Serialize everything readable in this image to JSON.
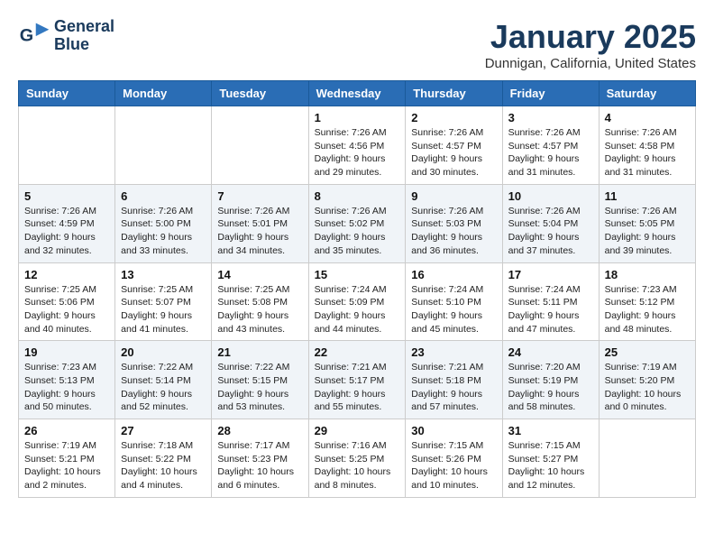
{
  "logo": {
    "line1": "General",
    "line2": "Blue"
  },
  "title": "January 2025",
  "location": "Dunnigan, California, United States",
  "days_of_week": [
    "Sunday",
    "Monday",
    "Tuesday",
    "Wednesday",
    "Thursday",
    "Friday",
    "Saturday"
  ],
  "weeks": [
    [
      {
        "day": "",
        "info": ""
      },
      {
        "day": "",
        "info": ""
      },
      {
        "day": "",
        "info": ""
      },
      {
        "day": "1",
        "info": "Sunrise: 7:26 AM\nSunset: 4:56 PM\nDaylight: 9 hours\nand 29 minutes."
      },
      {
        "day": "2",
        "info": "Sunrise: 7:26 AM\nSunset: 4:57 PM\nDaylight: 9 hours\nand 30 minutes."
      },
      {
        "day": "3",
        "info": "Sunrise: 7:26 AM\nSunset: 4:57 PM\nDaylight: 9 hours\nand 31 minutes."
      },
      {
        "day": "4",
        "info": "Sunrise: 7:26 AM\nSunset: 4:58 PM\nDaylight: 9 hours\nand 31 minutes."
      }
    ],
    [
      {
        "day": "5",
        "info": "Sunrise: 7:26 AM\nSunset: 4:59 PM\nDaylight: 9 hours\nand 32 minutes."
      },
      {
        "day": "6",
        "info": "Sunrise: 7:26 AM\nSunset: 5:00 PM\nDaylight: 9 hours\nand 33 minutes."
      },
      {
        "day": "7",
        "info": "Sunrise: 7:26 AM\nSunset: 5:01 PM\nDaylight: 9 hours\nand 34 minutes."
      },
      {
        "day": "8",
        "info": "Sunrise: 7:26 AM\nSunset: 5:02 PM\nDaylight: 9 hours\nand 35 minutes."
      },
      {
        "day": "9",
        "info": "Sunrise: 7:26 AM\nSunset: 5:03 PM\nDaylight: 9 hours\nand 36 minutes."
      },
      {
        "day": "10",
        "info": "Sunrise: 7:26 AM\nSunset: 5:04 PM\nDaylight: 9 hours\nand 37 minutes."
      },
      {
        "day": "11",
        "info": "Sunrise: 7:26 AM\nSunset: 5:05 PM\nDaylight: 9 hours\nand 39 minutes."
      }
    ],
    [
      {
        "day": "12",
        "info": "Sunrise: 7:25 AM\nSunset: 5:06 PM\nDaylight: 9 hours\nand 40 minutes."
      },
      {
        "day": "13",
        "info": "Sunrise: 7:25 AM\nSunset: 5:07 PM\nDaylight: 9 hours\nand 41 minutes."
      },
      {
        "day": "14",
        "info": "Sunrise: 7:25 AM\nSunset: 5:08 PM\nDaylight: 9 hours\nand 43 minutes."
      },
      {
        "day": "15",
        "info": "Sunrise: 7:24 AM\nSunset: 5:09 PM\nDaylight: 9 hours\nand 44 minutes."
      },
      {
        "day": "16",
        "info": "Sunrise: 7:24 AM\nSunset: 5:10 PM\nDaylight: 9 hours\nand 45 minutes."
      },
      {
        "day": "17",
        "info": "Sunrise: 7:24 AM\nSunset: 5:11 PM\nDaylight: 9 hours\nand 47 minutes."
      },
      {
        "day": "18",
        "info": "Sunrise: 7:23 AM\nSunset: 5:12 PM\nDaylight: 9 hours\nand 48 minutes."
      }
    ],
    [
      {
        "day": "19",
        "info": "Sunrise: 7:23 AM\nSunset: 5:13 PM\nDaylight: 9 hours\nand 50 minutes."
      },
      {
        "day": "20",
        "info": "Sunrise: 7:22 AM\nSunset: 5:14 PM\nDaylight: 9 hours\nand 52 minutes."
      },
      {
        "day": "21",
        "info": "Sunrise: 7:22 AM\nSunset: 5:15 PM\nDaylight: 9 hours\nand 53 minutes."
      },
      {
        "day": "22",
        "info": "Sunrise: 7:21 AM\nSunset: 5:17 PM\nDaylight: 9 hours\nand 55 minutes."
      },
      {
        "day": "23",
        "info": "Sunrise: 7:21 AM\nSunset: 5:18 PM\nDaylight: 9 hours\nand 57 minutes."
      },
      {
        "day": "24",
        "info": "Sunrise: 7:20 AM\nSunset: 5:19 PM\nDaylight: 9 hours\nand 58 minutes."
      },
      {
        "day": "25",
        "info": "Sunrise: 7:19 AM\nSunset: 5:20 PM\nDaylight: 10 hours\nand 0 minutes."
      }
    ],
    [
      {
        "day": "26",
        "info": "Sunrise: 7:19 AM\nSunset: 5:21 PM\nDaylight: 10 hours\nand 2 minutes."
      },
      {
        "day": "27",
        "info": "Sunrise: 7:18 AM\nSunset: 5:22 PM\nDaylight: 10 hours\nand 4 minutes."
      },
      {
        "day": "28",
        "info": "Sunrise: 7:17 AM\nSunset: 5:23 PM\nDaylight: 10 hours\nand 6 minutes."
      },
      {
        "day": "29",
        "info": "Sunrise: 7:16 AM\nSunset: 5:25 PM\nDaylight: 10 hours\nand 8 minutes."
      },
      {
        "day": "30",
        "info": "Sunrise: 7:15 AM\nSunset: 5:26 PM\nDaylight: 10 hours\nand 10 minutes."
      },
      {
        "day": "31",
        "info": "Sunrise: 7:15 AM\nSunset: 5:27 PM\nDaylight: 10 hours\nand 12 minutes."
      },
      {
        "day": "",
        "info": ""
      }
    ]
  ]
}
